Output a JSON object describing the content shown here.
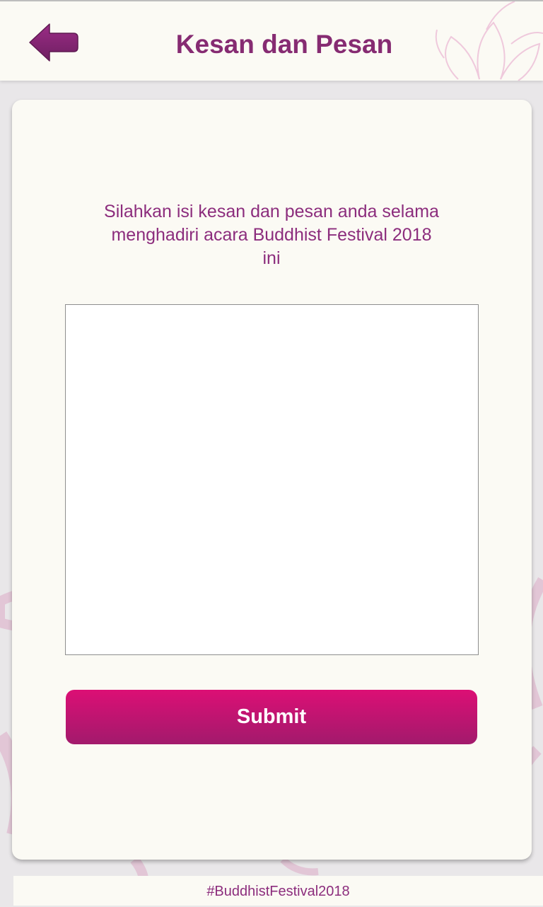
{
  "header": {
    "title": "Kesan dan Pesan",
    "back_icon": "back-arrow-icon"
  },
  "main": {
    "intro_text": "Silahkan isi kesan dan pesan anda selama menghadiri acara Buddhist Festival 2018 ini",
    "message_value": "",
    "submit_label": "Submit"
  },
  "footer": {
    "hashtag": "#BuddhistFestival2018"
  },
  "colors": {
    "brand_purple": "#862b72",
    "button_top": "#dc0f75",
    "button_bottom": "#a21a6c",
    "panel": "#fbfaf4",
    "background": "#e9e7e9"
  }
}
